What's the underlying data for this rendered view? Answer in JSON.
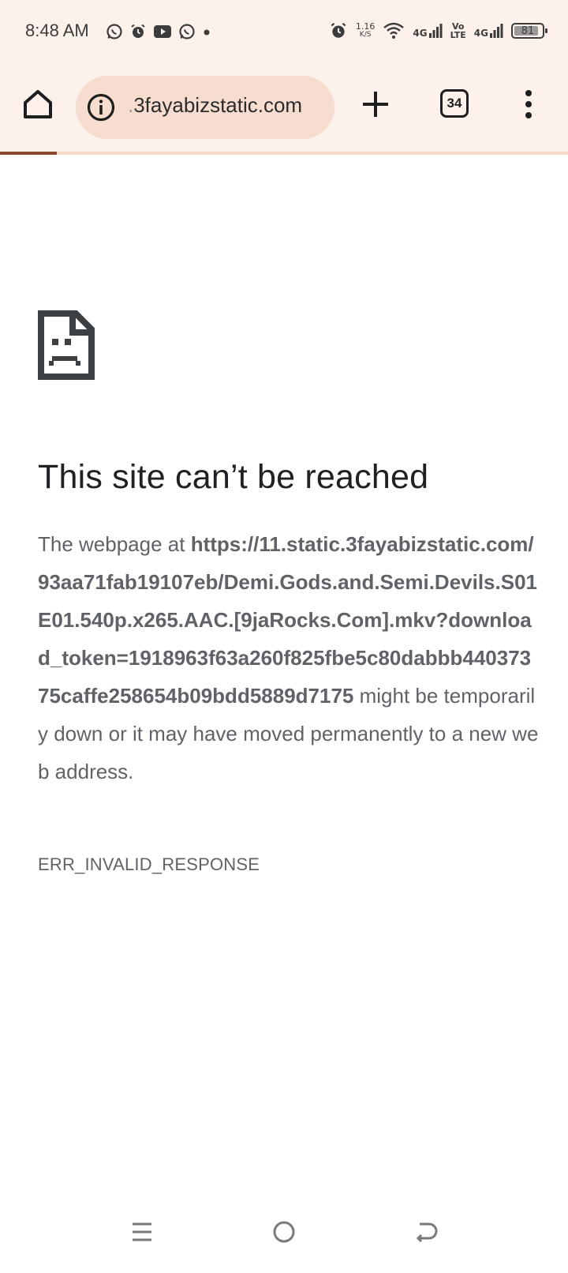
{
  "status_bar": {
    "time": "8:48 AM",
    "speed_value": "1.16",
    "speed_unit": "K/S",
    "net1": "4G",
    "volte_top": "Vo",
    "volte_bottom": "LTE",
    "net2": "4G",
    "battery": "81",
    "left_icons": [
      "whatsapp-icon",
      "alarm-icon",
      "youtube-icon",
      "whatsapp-icon",
      "dot-icon"
    ],
    "right_icons": [
      "alarm-icon",
      "wifi-icon",
      "signal-icon",
      "signal-icon",
      "battery-icon"
    ]
  },
  "toolbar": {
    "url_display": ".3fayabizstatic.com",
    "tab_count": "34",
    "load_progress": 0.1
  },
  "error_page": {
    "title": "This site can’t be reached",
    "intro": "The webpage at ",
    "url": "https://11.static.3fayabizstatic.com/93aa71fab19107eb/Demi.Gods.and.Semi.Devils.S01E01.540p.x265.AAC.[9jaRocks.Com].mkv?download_token=1918963f63a260f825fbe5c80dabbb44037375caffe258654b09bdd5889d7175",
    "outro": " might be temporarily down or it may have moved permanently to a new web address.",
    "error_code": "ERR_INVALID_RESPONSE"
  },
  "colors": {
    "toolbar_bg": "#fdf1ec",
    "omnibox_bg": "#f6ddd0",
    "progress": "#8b4a2b",
    "text_primary": "#202124",
    "text_secondary": "#5f6368"
  }
}
